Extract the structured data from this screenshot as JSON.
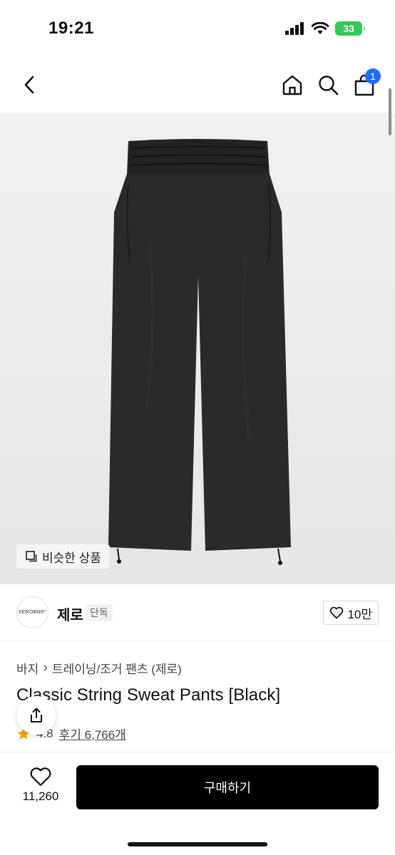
{
  "status_bar": {
    "time": "19:21",
    "battery": "33"
  },
  "nav": {
    "cart_count": "1"
  },
  "image": {
    "similar_label": "비슷한 상품"
  },
  "brand": {
    "logo_text": "XEROBNR°",
    "name": "제로",
    "tag": "단독",
    "likes": "10만"
  },
  "breadcrumb": {
    "category": "바지",
    "separator": "›",
    "subcategory": "트레이닝/조거 팬츠 (제로)"
  },
  "product": {
    "title": "Classic String Sweat Pants [Black]",
    "rating": "4.8",
    "reviews": "후기 6,766개"
  },
  "bottom": {
    "wish_count": "11,260",
    "buy_label": "구매하기"
  },
  "colors": {
    "accent": "#1f6bff",
    "battery": "#34c759",
    "buy_button": "#000000",
    "star": "#f7a400"
  },
  "icons": [
    "chevron-left-icon",
    "home-icon",
    "search-icon",
    "bag-icon",
    "copy-icon",
    "heart-icon",
    "share-icon",
    "star-icon"
  ]
}
